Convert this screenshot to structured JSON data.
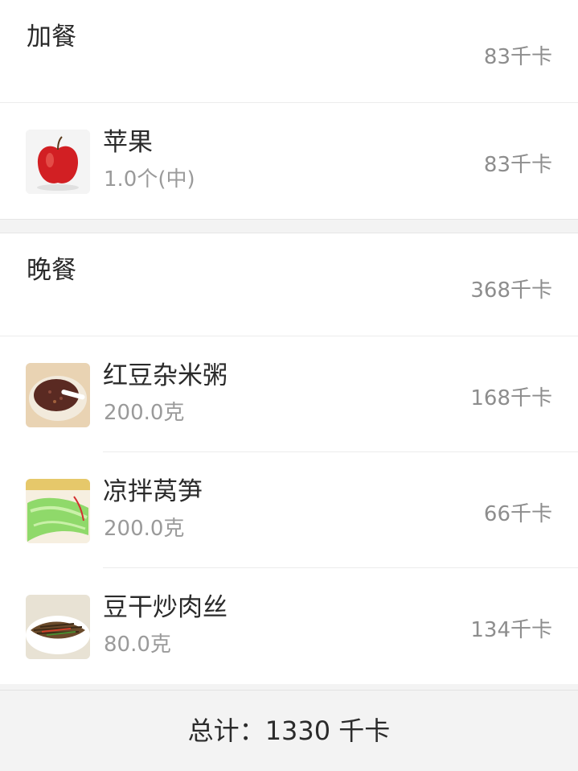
{
  "meals": [
    {
      "title": "加餐",
      "kcal": "83千卡",
      "items": [
        {
          "name": "苹果",
          "amount": "1.0个(中)",
          "kcal": "83千卡",
          "image": "apple-image"
        }
      ]
    },
    {
      "title": "晚餐",
      "kcal": "368千卡",
      "items": [
        {
          "name": "红豆杂米粥",
          "amount": "200.0克",
          "kcal": "168千卡",
          "image": "red-bean-porridge-image"
        },
        {
          "name": "凉拌莴笋",
          "amount": "200.0克",
          "kcal": "66千卡",
          "image": "lettuce-salad-image"
        },
        {
          "name": "豆干炒肉丝",
          "amount": "80.0克",
          "kcal": "134千卡",
          "image": "tofu-pork-image"
        }
      ]
    }
  ],
  "footer": {
    "total_label": "总计：",
    "total_value": "1330 千卡"
  }
}
